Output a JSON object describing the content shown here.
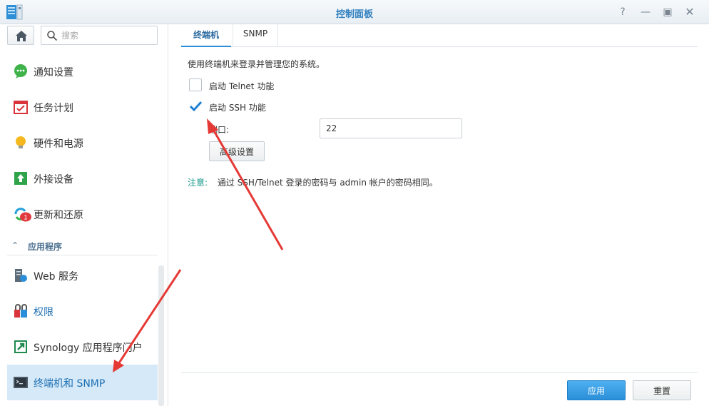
{
  "window": {
    "title": "控制面板",
    "controls": [
      "help-icon",
      "minimize-icon",
      "maximize-icon",
      "close-icon"
    ]
  },
  "sidebar": {
    "search_placeholder": "搜索",
    "items": [
      {
        "label": "通知设置",
        "icon": "chat-bubble-icon"
      },
      {
        "label": "任务计划",
        "icon": "calendar-icon"
      },
      {
        "label": "硬件和电源",
        "icon": "lightbulb-icon"
      },
      {
        "label": "外接设备",
        "icon": "external-device-icon"
      },
      {
        "label": "更新和还原",
        "icon": "update-restore-icon",
        "badge": "1"
      }
    ],
    "section": {
      "label": "应用程序"
    },
    "app_items": [
      {
        "label": "Web 服务",
        "icon": "server-icon"
      },
      {
        "label": "权限",
        "icon": "permissions-icon"
      },
      {
        "label": "Synology 应用程序门户",
        "icon": "app-portal-icon"
      },
      {
        "label": "终端机和 SNMP",
        "icon": "terminal-icon",
        "active": true
      }
    ]
  },
  "main": {
    "tabs": [
      {
        "label": "终端机",
        "active": true
      },
      {
        "label": "SNMP",
        "active": false
      }
    ],
    "description": "使用终端机来登录并管理您的系统。",
    "telnet": {
      "label": "启动 Telnet 功能",
      "checked": false
    },
    "ssh": {
      "label": "启动 SSH 功能",
      "checked": true
    },
    "port": {
      "label": "端口:",
      "value": "22"
    },
    "advanced_button": "高级设置",
    "note": {
      "prefix": "注意:",
      "text": "通过 SSH/Telnet 登录的密码与 admin 帐户的密码相同。"
    },
    "footer": {
      "apply": "应用",
      "reset": "重置"
    }
  },
  "colors": {
    "accent": "#2b8fd9",
    "title": "#2f7fbf",
    "active_nav_bg": "#d6e9f8",
    "note_prefix": "#1a9a8a",
    "annotation_arrow": "#e53935"
  }
}
